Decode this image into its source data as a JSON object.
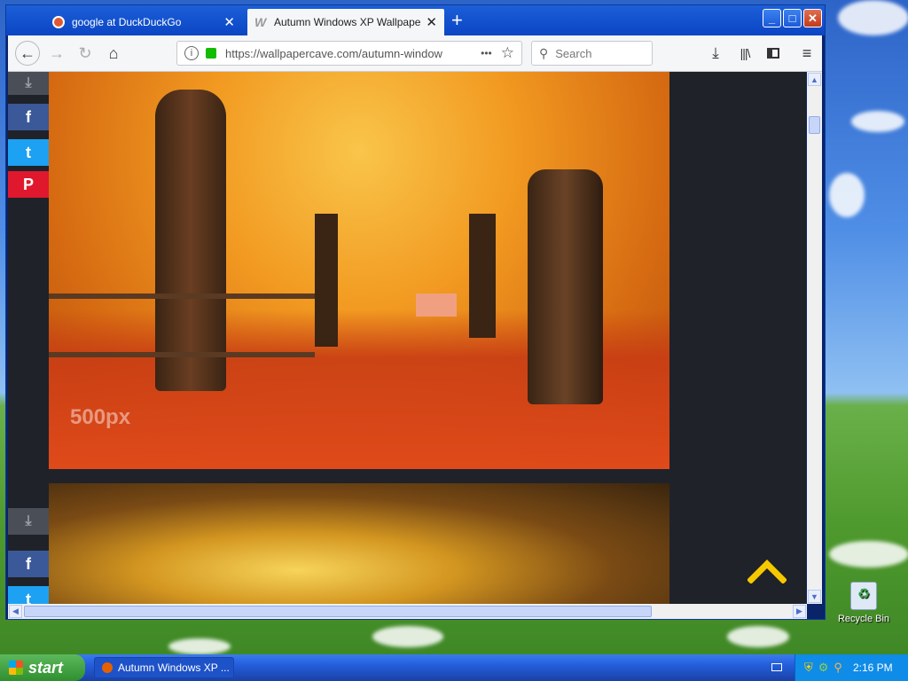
{
  "browser": {
    "tabs": [
      {
        "label": "google at DuckDuckGo",
        "active": false
      },
      {
        "label": "Autumn Windows XP Wallpapers -",
        "active": true
      }
    ],
    "new_tab_symbol": "+",
    "url": "https://wallpapercave.com/autumn-window",
    "url_more_symbol": "•••",
    "search_placeholder": "Search"
  },
  "page": {
    "social": [
      "f",
      "t",
      "P"
    ],
    "watermark": "500px"
  },
  "desktop": {
    "recycle_bin_label": "Recycle Bin"
  },
  "taskbar": {
    "start_label": "start",
    "task_label": "Autumn Windows XP ...",
    "clock": "2:16 PM"
  },
  "colors": {
    "facebook": "#3b5998",
    "twitter": "#1da1f2",
    "pinterest": "#e0182d",
    "scroll_top_arrow": "#f6c800",
    "tab_active_bg": "#f5f6f7",
    "xp_titlebar": "#0b45c4"
  },
  "icons": {
    "back": "arrow-left-icon",
    "forward": "arrow-right-icon",
    "reload": "reload-icon",
    "home": "home-icon",
    "info": "info-icon",
    "lock": "lock-icon",
    "bookmark": "star-icon",
    "download": "download-icon",
    "library": "library-icon",
    "sidebar": "sidebar-icon",
    "menu": "hamburger-menu-icon"
  }
}
